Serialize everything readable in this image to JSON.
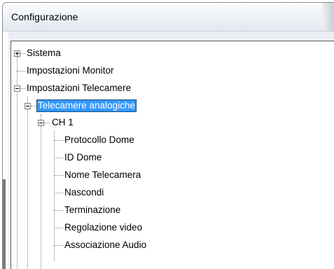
{
  "window": {
    "title": "Configurazione"
  },
  "tree": {
    "nodes": [
      {
        "label": "Sistema",
        "expander": "collapsed"
      },
      {
        "label": "Impostazioni Monitor",
        "expander": "none"
      },
      {
        "label": "Impostazioni Telecamere",
        "expander": "expanded"
      },
      {
        "label": "Telecamere analogiche",
        "expander": "expanded",
        "selected": true
      },
      {
        "label": "CH 1",
        "expander": "expanded"
      },
      {
        "label": "Protocollo Dome",
        "expander": "none"
      },
      {
        "label": "ID Dome",
        "expander": "none"
      },
      {
        "label": "Nome Telecamera",
        "expander": "none"
      },
      {
        "label": "Nascondi",
        "expander": "none"
      },
      {
        "label": "Terminazione",
        "expander": "none"
      },
      {
        "label": "Regolazione video",
        "expander": "none"
      },
      {
        "label": "Associazione Audio",
        "expander": "none"
      }
    ]
  },
  "colors": {
    "selection_background": "#3399ff",
    "selection_text": "#ffffff"
  }
}
